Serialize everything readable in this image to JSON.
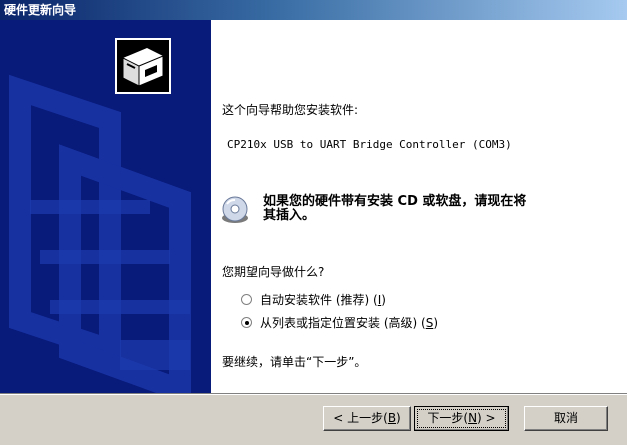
{
  "window": {
    "title": "硬件更新向导"
  },
  "wizard": {
    "intro": "这个向导帮助您安装软件:",
    "device_name": "CP210x USB to UART Bridge Controller (COM3)",
    "cd_prompt_line1": "如果您的硬件带有安装 CD 或软盘，请现在将",
    "cd_prompt_line2": "其插入。",
    "question": "您期望向导做什么?",
    "options": [
      {
        "label": "自动安装软件 (推荐) (",
        "hotkey": "I",
        "suffix": ")",
        "selected": false
      },
      {
        "label": "从列表或指定位置安装 (高级) (",
        "hotkey": "S",
        "suffix": ")",
        "selected": true
      }
    ],
    "continue_text": "要继续，请单击“下一步”。"
  },
  "buttons": {
    "back": {
      "label": "< 上一步(",
      "hotkey": "B",
      "suffix": ")"
    },
    "next": {
      "label": "下一步(",
      "hotkey": "N",
      "suffix": ") >"
    },
    "cancel": {
      "label": "取消"
    }
  },
  "icons": {
    "hardware": "hardware-box-icon",
    "cd": "cd-disc-icon"
  }
}
